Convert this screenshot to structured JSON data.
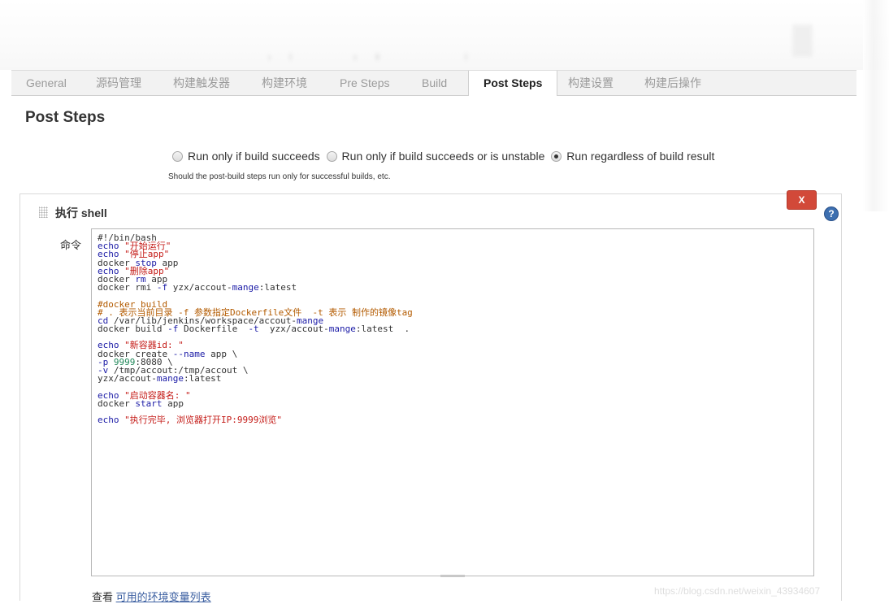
{
  "tabs": [
    {
      "label": "General"
    },
    {
      "label": "源码管理"
    },
    {
      "label": "构建触发器"
    },
    {
      "label": "构建环境"
    },
    {
      "label": "Pre Steps"
    },
    {
      "label": "Build"
    },
    {
      "label": "Post Steps",
      "active": true
    },
    {
      "label": "构建设置"
    },
    {
      "label": "构建后操作"
    }
  ],
  "section": {
    "title": "Post Steps",
    "options": [
      {
        "label": "Run only if build succeeds",
        "selected": false
      },
      {
        "label": "Run only if build succeeds or is unstable",
        "selected": false
      },
      {
        "label": "Run regardless of build result",
        "selected": true
      }
    ],
    "help_text": "Should the post-build steps run only for successful builds, etc."
  },
  "step": {
    "title": "执行 shell",
    "delete_label": "X",
    "help_icon": "?",
    "command_label": "命令",
    "command_lines": [
      "#!/bin/bash",
      "echo \"开始运行\"",
      "echo \"停止app\"",
      "docker stop app",
      "echo \"删除app\"",
      "docker rm app",
      "docker rmi -f yzx/accout-mange:latest",
      "",
      "#docker build",
      "# . 表示当前目录 -f 参数指定Dockerfile文件  -t 表示 制作的镜像tag",
      "cd /var/lib/jenkins/workspace/accout-mange",
      "docker build -f Dockerfile  -t  yzx/accout-mange:latest  .",
      "",
      "echo \"新容器id: \"",
      "docker create --name app \\",
      "-p 9999:8080 \\",
      "-v /tmp/accout:/tmp/accout \\",
      "yzx/accout-mange:latest",
      "",
      "echo \"启动容器名: \"",
      "docker start app",
      "",
      "echo \"执行完毕, 浏览器打开IP:9999浏览\""
    ]
  },
  "env_link": {
    "prefix": "查看",
    "link": "可用的环境变量列表"
  },
  "watermark": "https://blog.csdn.net/weixin_43934607",
  "colors": {
    "delete": "#d24939",
    "help": "#3d6fb0",
    "keyword_blue": "#1a1aa6",
    "string_red": "#c41a16",
    "comment_orange": "#b35b00"
  }
}
